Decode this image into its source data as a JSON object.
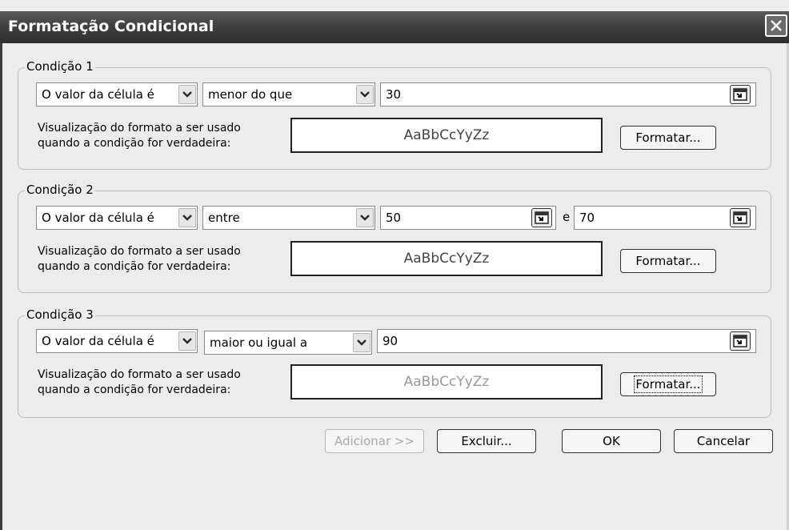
{
  "window": {
    "title": "Formatação Condicional"
  },
  "conditions": [
    {
      "legend": "Condição 1",
      "type": "O valor da célula é",
      "operator": "menor do que",
      "value1": "30",
      "value2": null,
      "desc_line1": "Visualização do formato a ser usado",
      "desc_line2": "quando a condição for verdadeira:",
      "preview": "AaBbCcYyZz",
      "format_button": "Formatar..."
    },
    {
      "legend": "Condição 2",
      "type": "O valor da célula é",
      "operator": "entre",
      "value1": "50",
      "between_label": "e",
      "value2": "70",
      "desc_line1": "Visualização do formato a ser usado",
      "desc_line2": "quando a condição for verdadeira:",
      "preview": "AaBbCcYyZz",
      "format_button": "Formatar..."
    },
    {
      "legend": "Condição 3",
      "type": "O valor da célula é",
      "operator": "maior ou igual a",
      "value1": "90",
      "value2": null,
      "desc_line1": "Visualização do formato a ser usado",
      "desc_line2": "quando a condição for verdadeira:",
      "preview": "AaBbCcYyZz",
      "format_button": "Formatar..."
    }
  ],
  "footer": {
    "add": "Adicionar >>",
    "delete": "Excluir...",
    "ok": "OK",
    "cancel": "Cancelar"
  }
}
